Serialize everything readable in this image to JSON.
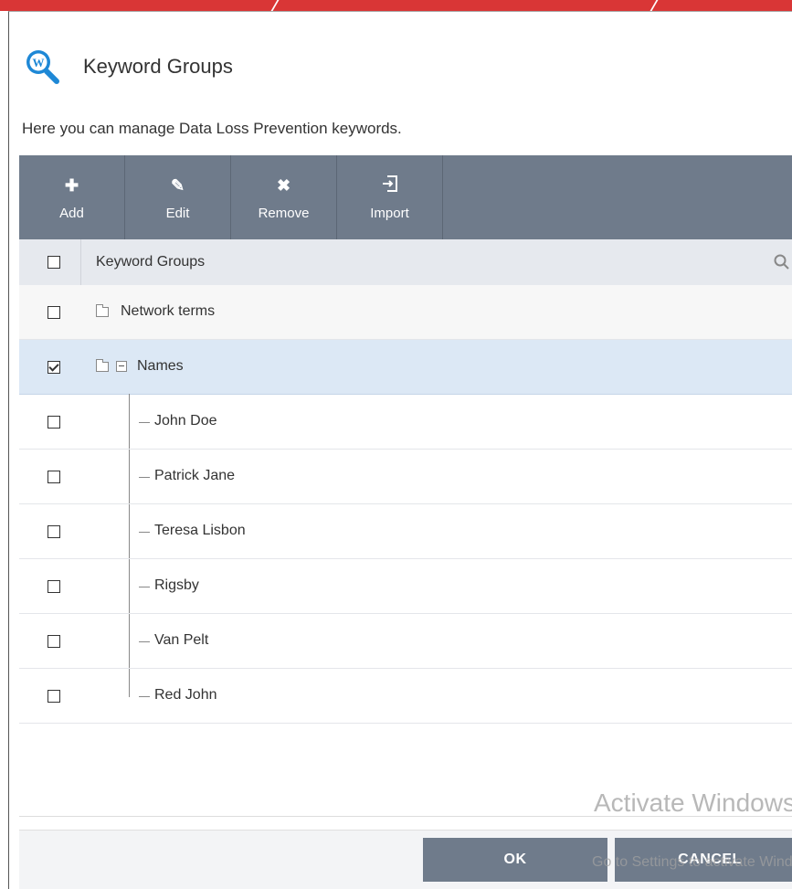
{
  "dialog": {
    "title": "Keyword Groups",
    "description": "Here you can manage Data Loss Prevention keywords."
  },
  "toolbar": {
    "buttons": [
      {
        "label": "Add",
        "icon": "plus-icon"
      },
      {
        "label": "Edit",
        "icon": "pencil-icon"
      },
      {
        "label": "Remove",
        "icon": "x-icon"
      },
      {
        "label": "Import",
        "icon": "import-icon"
      }
    ]
  },
  "grid": {
    "column_header": "Keyword Groups",
    "rows": [
      {
        "label": "Network terms",
        "level": 0,
        "checked": false
      },
      {
        "label": "Names",
        "level": 0,
        "checked": true,
        "expanded": true
      },
      {
        "label": "John Doe",
        "level": 1,
        "checked": false
      },
      {
        "label": "Patrick Jane",
        "level": 1,
        "checked": false
      },
      {
        "label": "Teresa Lisbon",
        "level": 1,
        "checked": false
      },
      {
        "label": "Rigsby",
        "level": 1,
        "checked": false
      },
      {
        "label": "Van Pelt",
        "level": 1,
        "checked": false
      },
      {
        "label": "Red John",
        "level": 1,
        "checked": false
      }
    ]
  },
  "footer": {
    "ok_label": "OK",
    "cancel_label": "CANCEL"
  },
  "watermark": {
    "line1": "Activate Windows",
    "line2": "Go to Settings to activate Windows."
  },
  "colors": {
    "accent_top": "#d93636",
    "toolbar": "#6f7b8b",
    "selected_row": "#dce8f5"
  }
}
